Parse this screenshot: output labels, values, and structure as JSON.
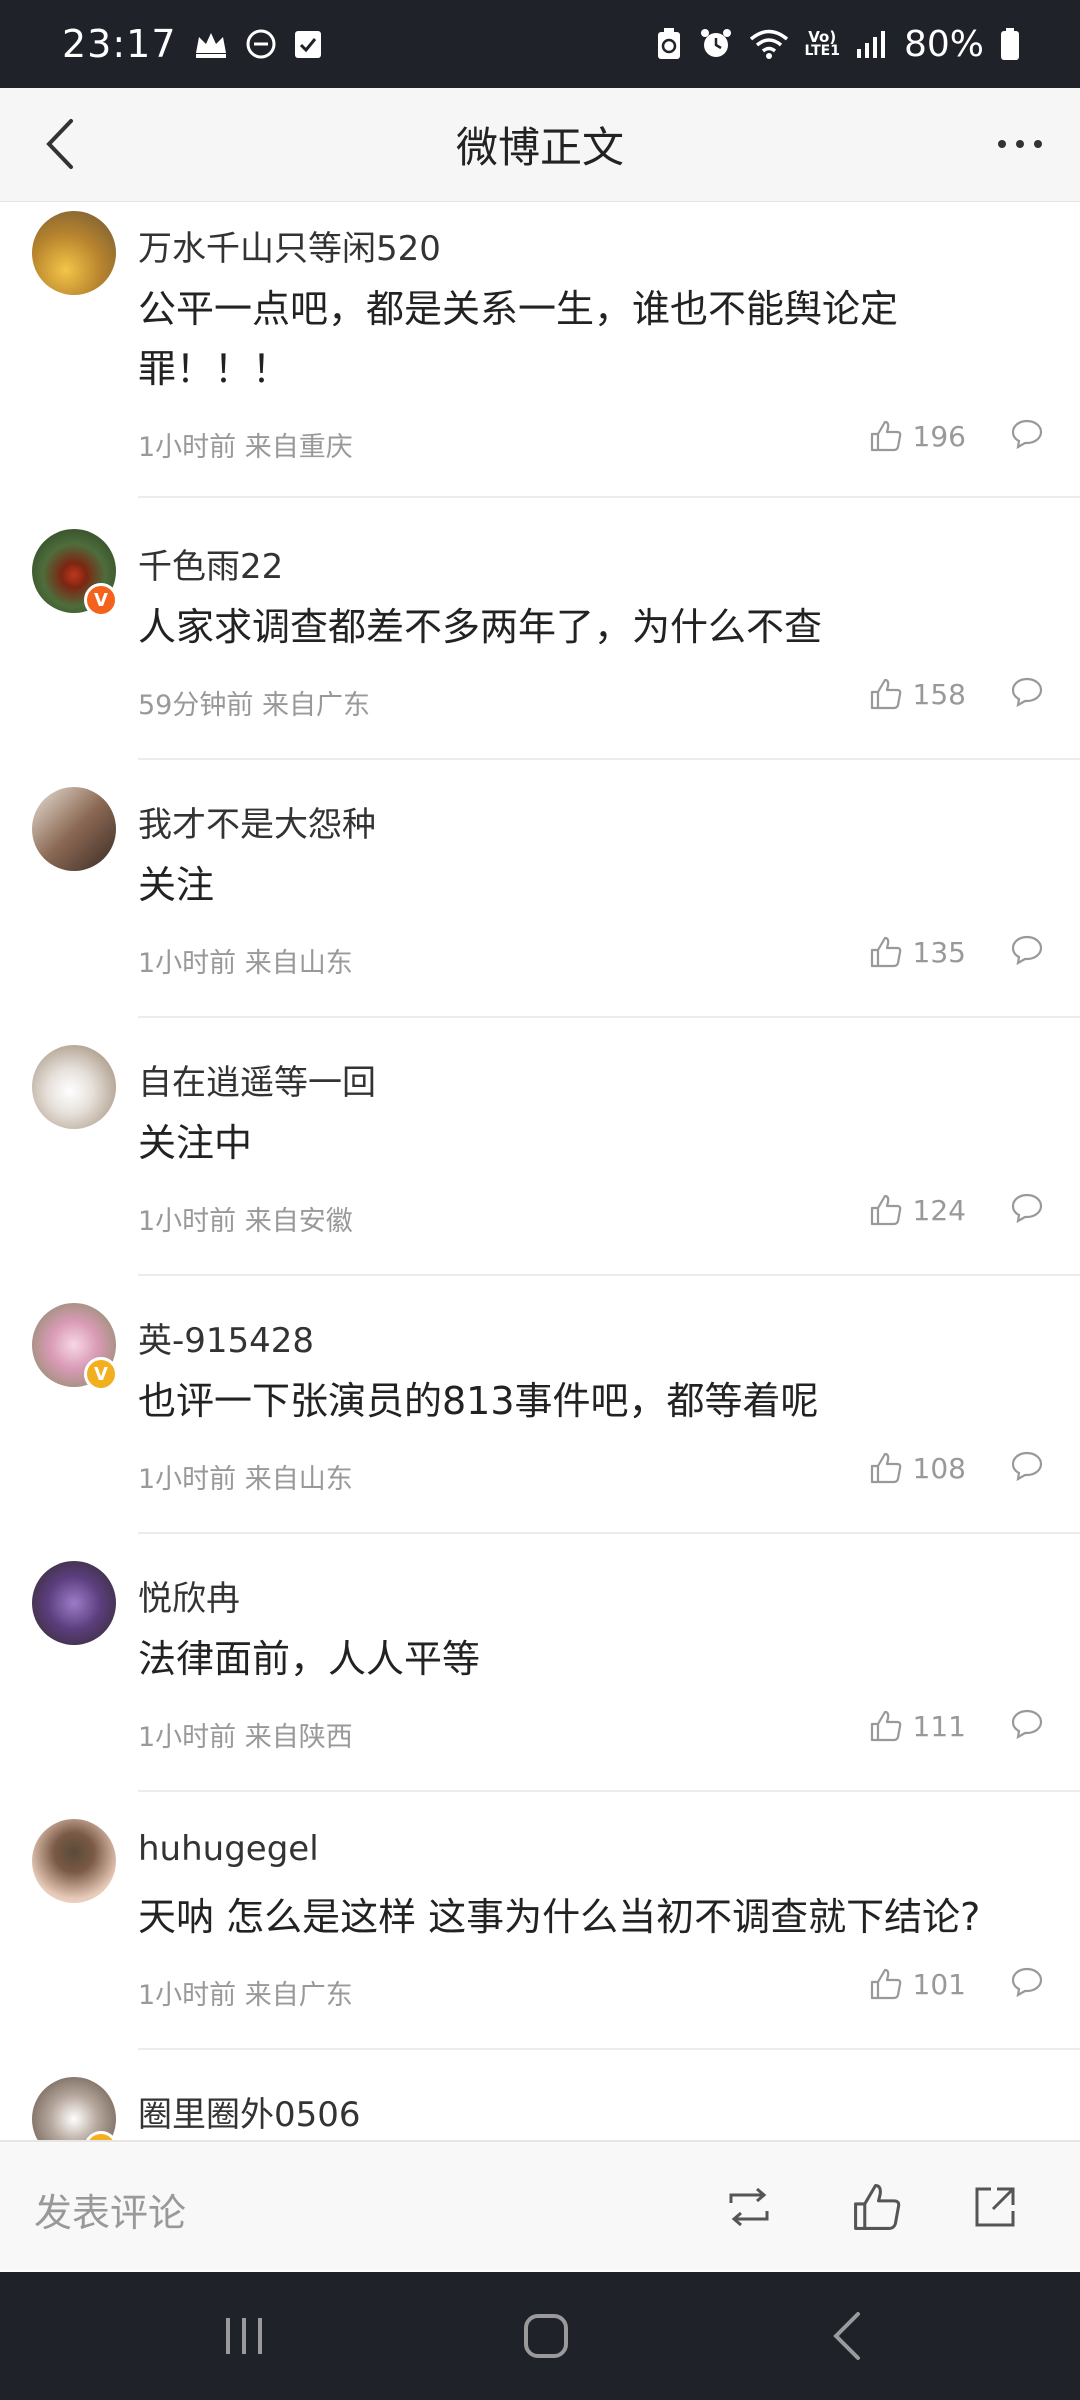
{
  "status_bar": {
    "time": "23:17",
    "battery": "80%",
    "network": "LTE1"
  },
  "nav": {
    "title": "微博正文"
  },
  "comments": [
    {
      "username": "万水千山只等闲520",
      "text": "公平一点吧，都是关系一生，谁也不能舆论定罪！！！",
      "meta": "1小时前 来自重庆",
      "likes": "196",
      "avatar_color": "#b9852e"
    },
    {
      "username": "千色雨22",
      "text": "人家求调查都差不多两年了，为什么不查",
      "meta": "59分钟前 来自广东",
      "likes": "158",
      "avatar_color": "#3f6b35",
      "badge": "V",
      "badge_color": "#f5621e"
    },
    {
      "username": "我才不是大怨种",
      "text": "关注",
      "meta": "1小时前 来自山东",
      "likes": "135",
      "avatar_color": "#8c6a55"
    },
    {
      "username": "自在逍遥等一回",
      "text": "关注中",
      "meta": "1小时前 来自安徽",
      "likes": "124",
      "avatar_color": "#cfc6bd"
    },
    {
      "username": "英-915428",
      "text": "也评一下张演员的813事件吧，都等着呢",
      "meta": "1小时前 来自山东",
      "likes": "108",
      "avatar_color": "#d99bb6",
      "badge": "V",
      "badge_color": "#f2b01e"
    },
    {
      "username": "悦欣冉",
      "text": "法律面前，人人平等",
      "meta": "1小时前 来自陕西",
      "likes": "111",
      "avatar_color": "#5b3e7d"
    },
    {
      "username": "huhugegel",
      "text": "天呐 怎么是这样 这事为什么当初不调查就下结论?",
      "meta": "1小时前 来自广东",
      "likes": "101",
      "avatar_color": "#7a5a45"
    },
    {
      "username": "圈里圈外0506",
      "text": "",
      "meta": "",
      "likes": "",
      "avatar_color": "#5a4a40",
      "badge": "V",
      "badge_color": "#f2b01e"
    }
  ],
  "bottom_bar": {
    "comment_placeholder": "发表评论"
  },
  "icons": {
    "back": "chevron-left-icon",
    "more": "more-icon",
    "like": "thumb-up-icon",
    "reply": "comment-bubble-icon",
    "repost": "repost-icon",
    "share": "share-icon",
    "recents": "recents-icon",
    "home": "home-icon",
    "sys_back": "back-icon"
  },
  "colors": {
    "status_bg": "#1f2229",
    "nav_bg": "#f6f6f6",
    "meta_text": "#999999"
  }
}
